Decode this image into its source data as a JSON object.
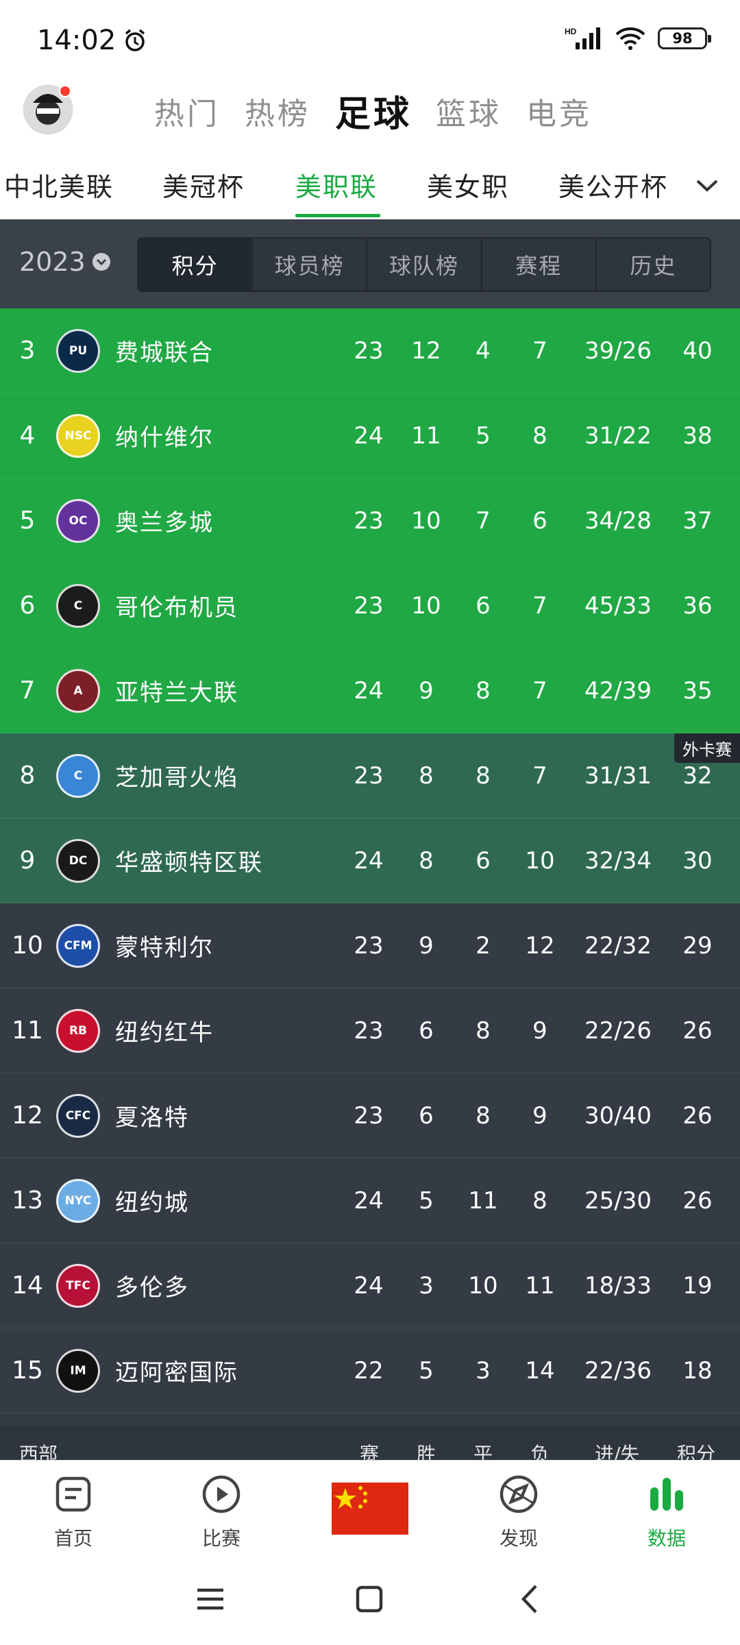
{
  "status": {
    "time": "14:02",
    "battery": "98",
    "network": "HD"
  },
  "sport_tabs": [
    {
      "label": "热门"
    },
    {
      "label": "热榜"
    },
    {
      "label": "足球"
    },
    {
      "label": "篮球"
    },
    {
      "label": "电竞"
    }
  ],
  "league_tabs": [
    {
      "label": "中北美联"
    },
    {
      "label": "美冠杯"
    },
    {
      "label": "美职联"
    },
    {
      "label": "美女职"
    },
    {
      "label": "美公开杯"
    }
  ],
  "season": {
    "year": "2023"
  },
  "segments": [
    {
      "label": "积分"
    },
    {
      "label": "球员榜"
    },
    {
      "label": "球队榜"
    },
    {
      "label": "赛程"
    },
    {
      "label": "历史"
    }
  ],
  "rows": [
    {
      "rank": "3",
      "team": "费城联合",
      "played": "23",
      "won": "12",
      "drawn": "4",
      "lost": "7",
      "goals": "39/26",
      "points": "40",
      "logo_color": "#0b2a4a",
      "logo_text": "PU"
    },
    {
      "rank": "4",
      "team": "纳什维尔",
      "played": "24",
      "won": "11",
      "drawn": "5",
      "lost": "8",
      "goals": "31/22",
      "points": "38",
      "logo_color": "#e8d21f",
      "logo_text": "NSC"
    },
    {
      "rank": "5",
      "team": "奥兰多城",
      "played": "23",
      "won": "10",
      "drawn": "7",
      "lost": "6",
      "goals": "34/28",
      "points": "37",
      "logo_color": "#63329b",
      "logo_text": "OC"
    },
    {
      "rank": "6",
      "team": "哥伦布机员",
      "played": "23",
      "won": "10",
      "drawn": "6",
      "lost": "7",
      "goals": "45/33",
      "points": "36",
      "logo_color": "#1c1c1c",
      "logo_text": "C"
    },
    {
      "rank": "7",
      "team": "亚特兰大联",
      "played": "24",
      "won": "9",
      "drawn": "8",
      "lost": "7",
      "goals": "42/39",
      "points": "35",
      "logo_color": "#7c1f26",
      "logo_text": "A"
    },
    {
      "rank": "8",
      "team": "芝加哥火焰",
      "played": "23",
      "won": "8",
      "drawn": "8",
      "lost": "7",
      "goals": "31/31",
      "points": "32",
      "logo_color": "#3a86d6",
      "logo_text": "C"
    },
    {
      "rank": "9",
      "team": "华盛顿特区联",
      "played": "24",
      "won": "8",
      "drawn": "6",
      "lost": "10",
      "goals": "32/34",
      "points": "30",
      "logo_color": "#1a1a1a",
      "logo_text": "DC"
    },
    {
      "rank": "10",
      "team": "蒙特利尔",
      "played": "23",
      "won": "9",
      "drawn": "2",
      "lost": "12",
      "goals": "22/32",
      "points": "29",
      "logo_color": "#1d4fa8",
      "logo_text": "CFM"
    },
    {
      "rank": "11",
      "team": "纽约红牛",
      "played": "23",
      "won": "6",
      "drawn": "8",
      "lost": "9",
      "goals": "22/26",
      "points": "26",
      "logo_color": "#c8102e",
      "logo_text": "RB"
    },
    {
      "rank": "12",
      "team": "夏洛特",
      "played": "23",
      "won": "6",
      "drawn": "8",
      "lost": "9",
      "goals": "30/40",
      "points": "26",
      "logo_color": "#1a2a44",
      "logo_text": "CFC"
    },
    {
      "rank": "13",
      "team": "纽约城",
      "played": "24",
      "won": "5",
      "drawn": "11",
      "lost": "8",
      "goals": "25/30",
      "points": "26",
      "logo_color": "#6cace4",
      "logo_text": "NYC"
    },
    {
      "rank": "14",
      "team": "多伦多",
      "played": "24",
      "won": "3",
      "drawn": "10",
      "lost": "11",
      "goals": "18/33",
      "points": "19",
      "logo_color": "#b81137",
      "logo_text": "TFC"
    },
    {
      "rank": "15",
      "team": "迈阿密国际",
      "played": "22",
      "won": "5",
      "drawn": "3",
      "lost": "14",
      "goals": "22/36",
      "points": "18",
      "logo_color": "#111111",
      "logo_text": "IM"
    }
  ],
  "wildcard_badge": "外卡赛",
  "west_header": {
    "title": "西部",
    "played": "赛",
    "won": "胜",
    "drawn": "平",
    "lost": "负",
    "goals": "进/失",
    "points": "积分"
  },
  "bottom_nav": [
    {
      "label": "首页"
    },
    {
      "label": "比赛"
    },
    {
      "label": "发现"
    },
    {
      "label": "数据"
    }
  ],
  "colors": {
    "accent": "#1aaa41",
    "playoff": "#20a844",
    "wildcard": "#2f6952",
    "table_bg": "#343b44"
  }
}
